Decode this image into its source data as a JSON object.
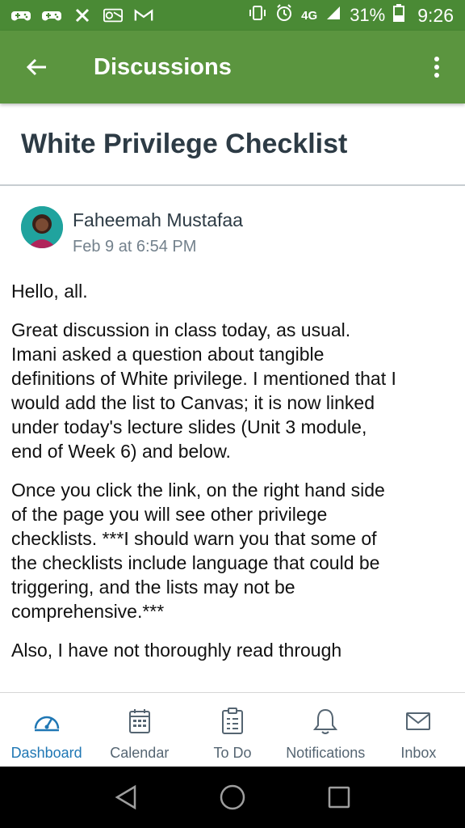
{
  "status_bar": {
    "icons": [
      "gamepad-icon",
      "gamepad-icon",
      "x-icon",
      "outlook-icon",
      "gmail-icon"
    ],
    "network": "4G",
    "battery": "31%",
    "time": "9:26"
  },
  "app_bar": {
    "title": "Discussions"
  },
  "discussion": {
    "title": "White Privilege Checklist",
    "author": "Faheemah Mustafaa",
    "date": "Feb 9 at 6:54 PM",
    "paragraphs": [
      "Hello, all.",
      "Great discussion in class today, as usual. Imani asked a question about tangible definitions of White privilege. I mentioned that I would add the list to Canvas; it is now linked under today's lecture slides (Unit 3 module, end of Week 6) and below.",
      "Once you click the link, on the right hand side of the page you will see other privilege checklists. ***I should warn you that some of the checklists include language that could be triggering, and the lists may not be comprehensive.***",
      "Also, I have not thoroughly read through"
    ]
  },
  "tabs": [
    {
      "label": "Dashboard",
      "icon": "dashboard-icon",
      "active": true
    },
    {
      "label": "Calendar",
      "icon": "calendar-icon",
      "active": false
    },
    {
      "label": "To Do",
      "icon": "todo-icon",
      "active": false
    },
    {
      "label": "Notifications",
      "icon": "bell-icon",
      "active": false
    },
    {
      "label": "Inbox",
      "icon": "mail-icon",
      "active": false
    }
  ],
  "colors": {
    "status_bar": "#4a8a35",
    "app_bar": "#5b953f",
    "active_tab": "#1f77b4"
  }
}
